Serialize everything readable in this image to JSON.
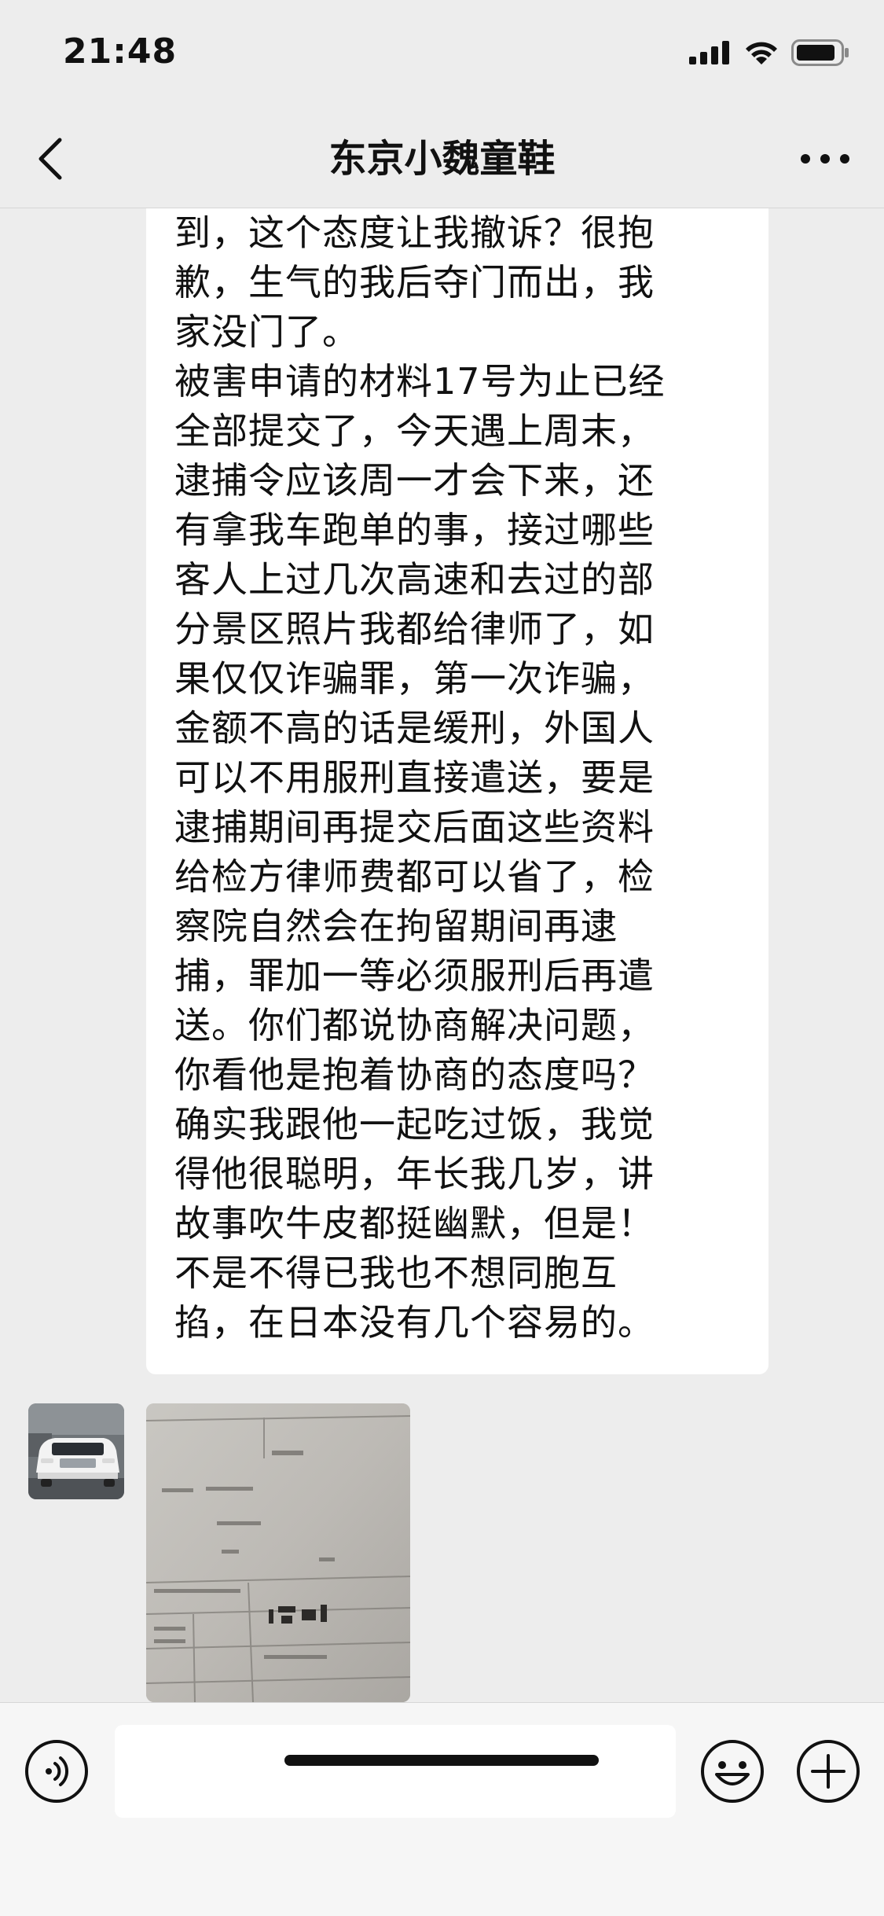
{
  "status_bar": {
    "time": "21:48",
    "icons": [
      "signal-icon",
      "wifi-icon",
      "battery-icon"
    ]
  },
  "header": {
    "back_icon": "chevron-left-icon",
    "title": "东京小魏童鞋",
    "more_icon": "more-dots-icon"
  },
  "messages": [
    {
      "type": "text",
      "side": "left",
      "text": "到，这个态度让我撤诉？很抱\n歉，生气的我后夺门而出，我\n家没门了。\n被害申请的材料17号为止已经\n全部提交了，今天遇上周末，\n逮捕令应该周一才会下来，还\n有拿我车跑单的事，接过哪些\n客人上过几次高速和去过的部\n分景区照片我都给律师了，如\n果仅仅诈骗罪，第一次诈骗，\n金额不高的话是缓刑，外国人\n可以不用服刑直接遣送，要是\n逮捕期间再提交后面这些资料\n给检方律师费都可以省了，检\n察院自然会在拘留期间再逮\n捕，罪加一等必须服刑后再遣\n送。你们都说协商解决问题，\n你看他是抱着协商的态度吗？\n确实我跟他一起吃过饭，我觉\n得他很聪明，年长我几岁，讲\n故事吹牛皮都挺幽默，但是！\n不是不得已我也不想同胞互\n掐，在日本没有几个容易的。"
    },
    {
      "type": "image",
      "side": "left",
      "avatar": "white-minivan-avatar",
      "content": "photo of a Japanese official document"
    }
  ],
  "input_bar": {
    "voice_icon": "voice-icon",
    "input_value": "",
    "emoji_icon": "emoji-icon",
    "add_icon": "plus-circle-icon"
  },
  "colors": {
    "background": "#ededed",
    "bubble": "#ffffff",
    "input_bar": "#f6f6f6",
    "text": "#111111"
  }
}
